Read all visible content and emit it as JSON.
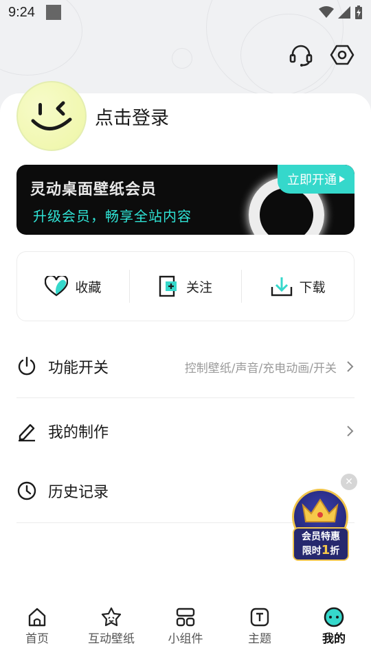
{
  "status_bar": {
    "time": "9:24"
  },
  "profile": {
    "login_text": "点击登录"
  },
  "vip_banner": {
    "title": "灵动桌面壁纸会员",
    "subtitle": "升级会员，畅享全站内容",
    "button_label": "立即开通",
    "accent_color": "#35d8cb"
  },
  "quick_actions": [
    {
      "label": "收藏",
      "icon": "heart-icon"
    },
    {
      "label": "关注",
      "icon": "follow-icon"
    },
    {
      "label": "下载",
      "icon": "download-icon"
    }
  ],
  "menu": [
    {
      "label": "功能开关",
      "hint": "控制壁纸/声音/充电动画/开关",
      "icon": "power-icon"
    },
    {
      "label": "我的制作",
      "hint": "",
      "icon": "pencil-icon"
    },
    {
      "label": "历史记录",
      "hint": "",
      "icon": "clock-icon"
    }
  ],
  "promo": {
    "line1": "会员特惠",
    "line2_a": "限时",
    "line2_b": "1",
    "line2_c": "折"
  },
  "tabbar": [
    {
      "label": "首页",
      "icon": "home-icon",
      "active": false
    },
    {
      "label": "互动壁纸",
      "icon": "interactive-wallpaper-icon",
      "active": false
    },
    {
      "label": "小组件",
      "icon": "widgets-icon",
      "active": false
    },
    {
      "label": "主题",
      "icon": "theme-icon",
      "active": false
    },
    {
      "label": "我的",
      "icon": "profile-icon",
      "active": true
    }
  ]
}
